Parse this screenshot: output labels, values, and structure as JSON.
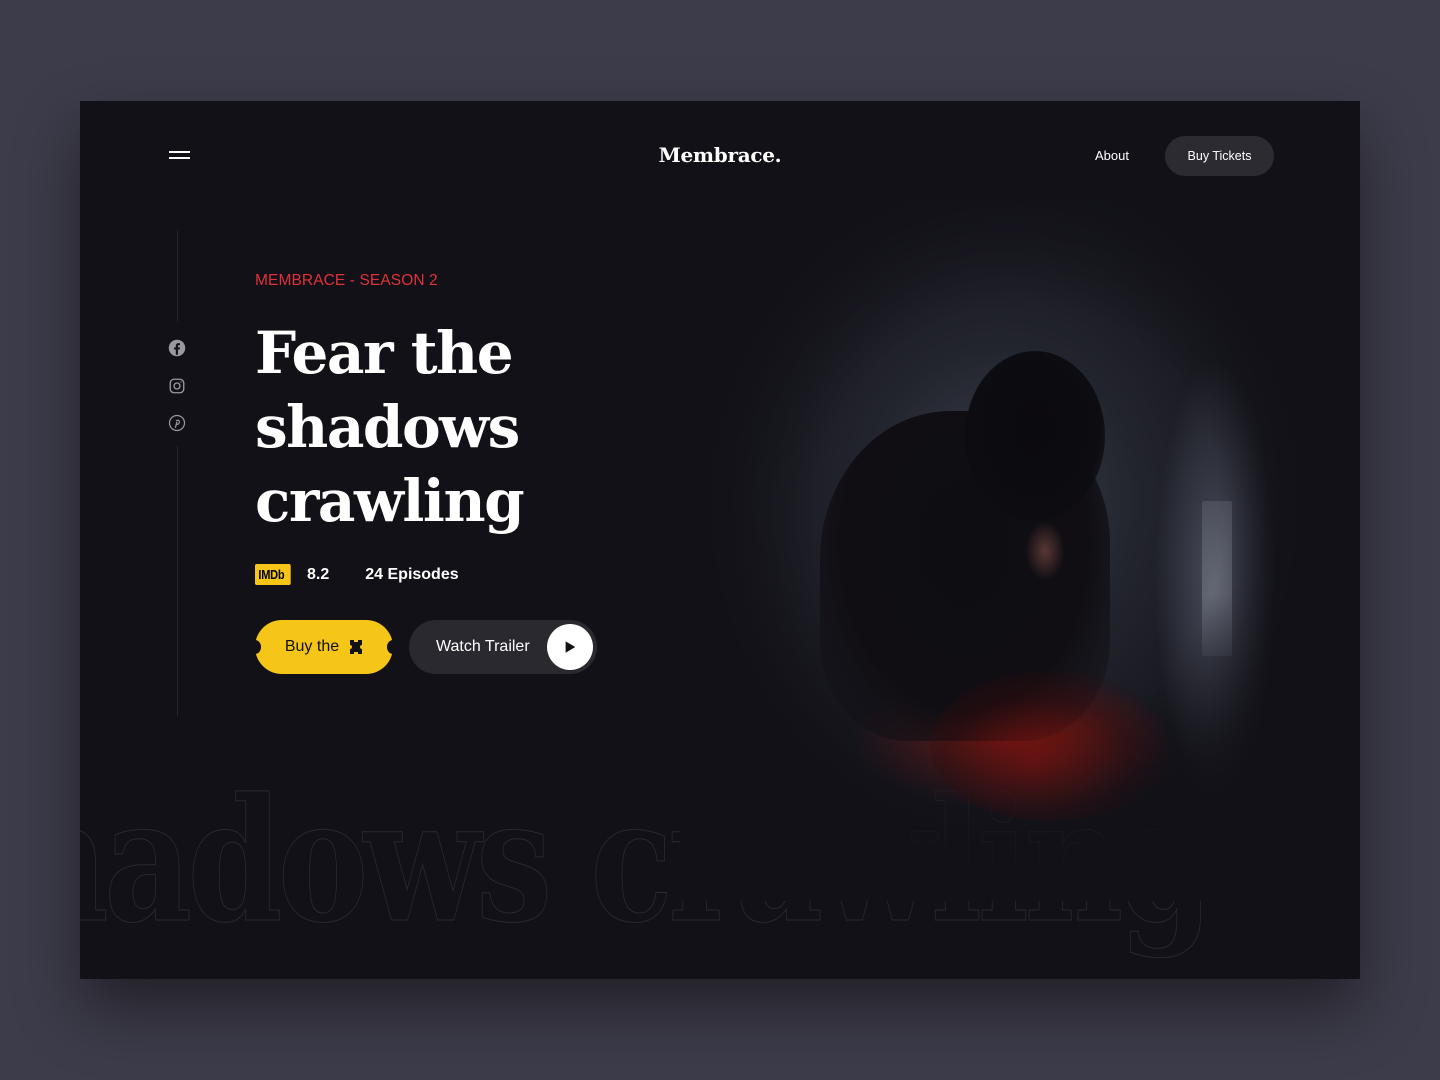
{
  "header": {
    "logo": "Membrace.",
    "nav_about": "About",
    "nav_buy_tickets": "Buy Tickets"
  },
  "social": [
    {
      "icon": "facebook-icon"
    },
    {
      "icon": "instagram-icon"
    },
    {
      "icon": "pinterest-icon"
    }
  ],
  "hero": {
    "eyebrow": "MEMBRACE - SEASON 2",
    "headline_lines": [
      "Fear the",
      "shadows",
      "crawling"
    ],
    "imdb_badge": "IMDb",
    "rating": "8.2",
    "episodes": "24 Episodes",
    "buy_button": "Buy the",
    "trailer_button": "Watch Trailer",
    "background_text": "hadows crawling"
  },
  "colors": {
    "accent_red": "#e0323a",
    "imdb_yellow": "#f5c518",
    "background": "#121118"
  }
}
